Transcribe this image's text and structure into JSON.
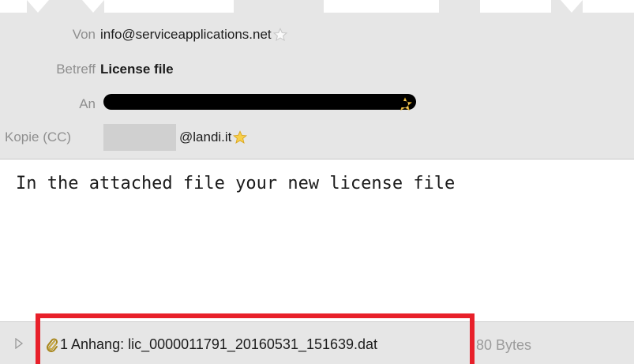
{
  "header": {
    "from": {
      "label": "Von",
      "value": "info@serviceapplications.net"
    },
    "subject": {
      "label": "Betreff",
      "value": "License file"
    },
    "to": {
      "label": "An"
    },
    "cc": {
      "label": "Kopie (CC)",
      "value": "@landi.it"
    }
  },
  "message": {
    "body": "In the attached file your new license file"
  },
  "attachment": {
    "summary": "1 Anhang: lic_0000011791_20160531_151639.dat",
    "size": "80 Bytes"
  },
  "colors": {
    "header_bg": "#e6e6e6",
    "highlight": "#e8202a",
    "star": "#f5c518"
  },
  "icons": {
    "star": "star-icon",
    "expand": "chevron-right-icon",
    "attachment": "paperclip-icon"
  }
}
